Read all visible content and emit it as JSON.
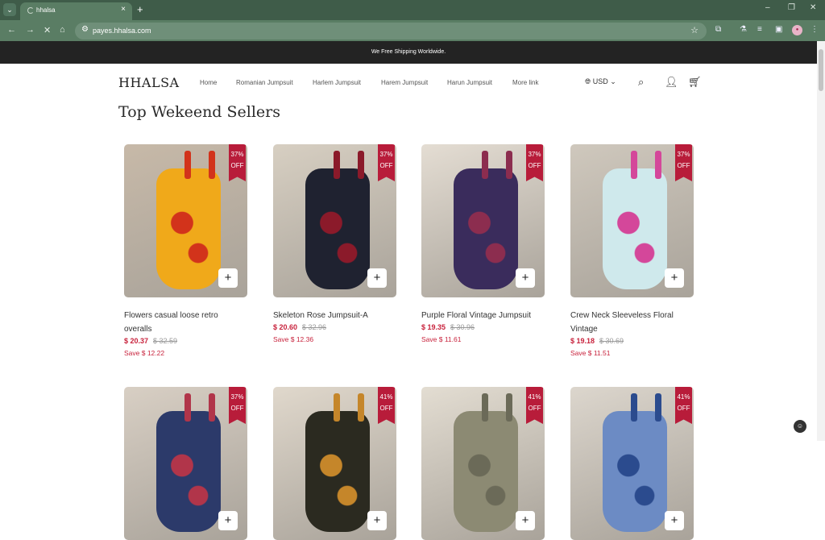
{
  "browser": {
    "tab_title": "hhalsa",
    "url": "payes.hhalsa.com",
    "menu_icon": "chevron-down-icon",
    "new_tab": "+",
    "tab_close": "×",
    "minimize": "–",
    "restore": "❐",
    "close": "✕"
  },
  "announcement": "We Free Shipping Worldwide.",
  "header": {
    "logo": "HHALSA",
    "nav": [
      "Home",
      "Romanian Jumpsuit",
      "Harlem Jumpsuit",
      "Harem Jumpsuit",
      "Harun Jumpsuit",
      "More link"
    ],
    "currency": "USD"
  },
  "section_title": "Top Wekeend Sellers",
  "products": [
    {
      "name": "Flowers casual loose retro overalls",
      "price": "$ 20.37",
      "was": "$ 32.59",
      "save": "Save $ 12.22",
      "discount_pct": "37%",
      "discount_off": "OFF",
      "colors": [
        "#f0a91a",
        "#d2331b",
        "#c7b9a8"
      ]
    },
    {
      "name": "Skeleton Rose Jumpsuit-A",
      "price": "$ 20.60",
      "was": "$ 32.96",
      "save": "Save $ 12.36",
      "discount_pct": "37%",
      "discount_off": "OFF",
      "colors": [
        "#1f2230",
        "#8b1a2a",
        "#d7cfc2"
      ]
    },
    {
      "name": "Purple Floral Vintage Jumpsuit",
      "price": "$ 19.35",
      "was": "$ 30.96",
      "save": "Save $ 11.61",
      "discount_pct": "37%",
      "discount_off": "OFF",
      "colors": [
        "#3a2c5c",
        "#8c2d4f",
        "#e4ddd3"
      ]
    },
    {
      "name": "Crew Neck Sleeveless Floral Vintage",
      "price": "$ 19.18",
      "was": "$ 30.69",
      "save": "Save $ 11.51",
      "discount_pct": "37%",
      "discount_off": "OFF",
      "colors": [
        "#cfe9ec",
        "#d4479a",
        "#cfc8bd"
      ]
    },
    {
      "discount_pct": "37%",
      "discount_off": "OFF",
      "colors": [
        "#2c3a6a",
        "#b1354a",
        "#d8cfc4"
      ]
    },
    {
      "discount_pct": "41%",
      "discount_off": "OFF",
      "colors": [
        "#2b2a20",
        "#c5862a",
        "#e0d8cc"
      ]
    },
    {
      "discount_pct": "41%",
      "discount_off": "OFF",
      "colors": [
        "#8c8a73",
        "#6b6a58",
        "#e3ddd2"
      ]
    },
    {
      "discount_pct": "41%",
      "discount_off": "OFF",
      "colors": [
        "#6c8bc4",
        "#2b4b8e",
        "#dcd6cd"
      ]
    }
  ]
}
